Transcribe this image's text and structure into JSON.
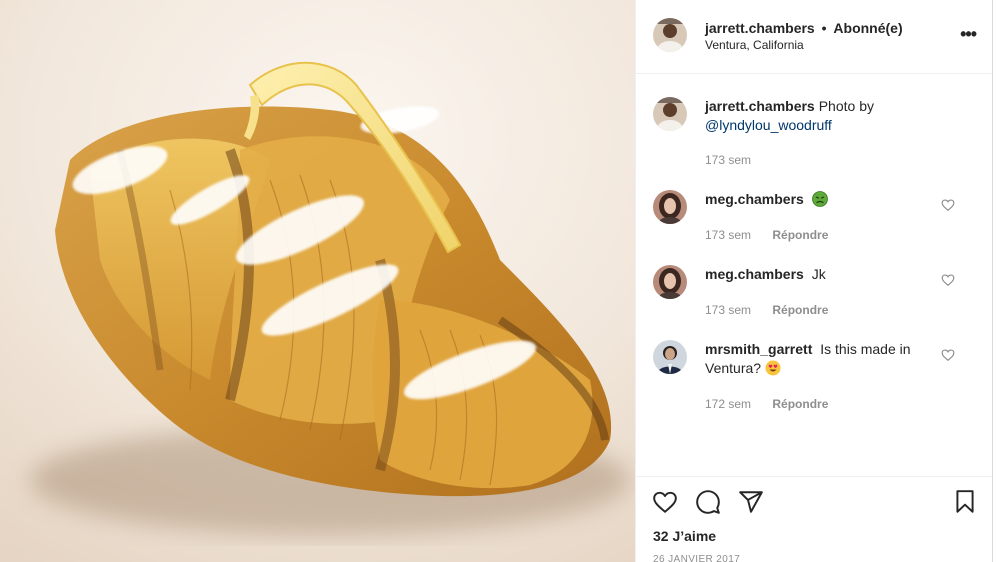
{
  "post": {
    "author": "jarrett.chambers",
    "separator": "•",
    "follow_status": "Abonné(e)",
    "location": "Ventura, California",
    "more_label": "•••",
    "photo_alt": "croissant-photo"
  },
  "caption": {
    "username": "jarrett.chambers",
    "text": "Photo by",
    "mention": "@lyndylou_woodruff",
    "time": "173 sem"
  },
  "comments": [
    {
      "username": "meg.chambers",
      "text": "",
      "emoji": "nauseated-face",
      "time": "173 sem",
      "reply": "Répondre"
    },
    {
      "username": "meg.chambers",
      "text": "Jk",
      "time": "173 sem",
      "reply": "Répondre"
    },
    {
      "username": "mrsmith_garrett",
      "text": "Is this made in Ventura?",
      "emoji": "heart-eyes-face",
      "time": "172 sem",
      "reply": "Répondre"
    }
  ],
  "footer": {
    "likes": "32 J’aime",
    "date": "26 JANVIER 2017"
  },
  "colors": {
    "text": "#262626",
    "muted": "#8e8e8e",
    "link": "#00376b",
    "border": "#efefef"
  }
}
